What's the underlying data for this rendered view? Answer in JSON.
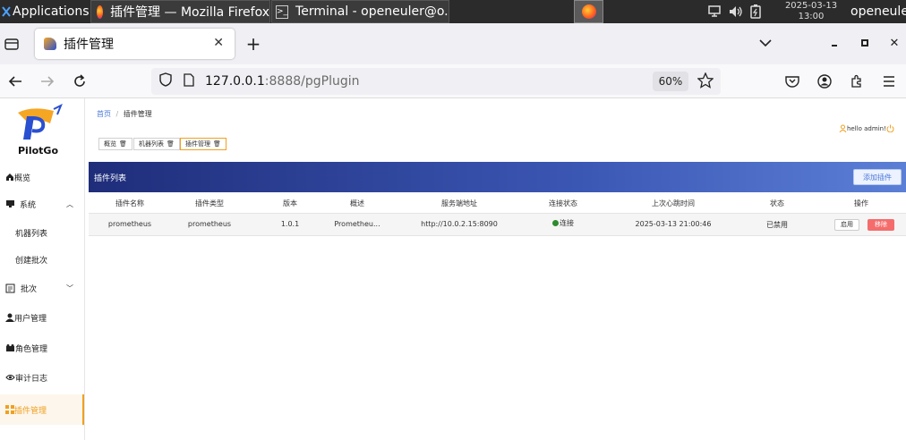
{
  "taskbar": {
    "apps_label": "Applications",
    "firefox_window": "插件管理 — Mozilla Firefox",
    "terminal_window": "Terminal - openeuler@o...",
    "date": "2025-03-13",
    "time": "13:00",
    "user": "openeuler"
  },
  "browser": {
    "tab_title": "插件管理",
    "url_host": "127.0.0.1",
    "url_rest": ":8888/pgPlugin",
    "zoom": "60%"
  },
  "sidebar": {
    "logo_text": "PilotGo",
    "items": [
      {
        "label": "概览"
      },
      {
        "label": "系统"
      },
      {
        "label": "机器列表"
      },
      {
        "label": "创建批次"
      },
      {
        "label": "批次"
      },
      {
        "label": "用户管理"
      },
      {
        "label": "角色管理"
      },
      {
        "label": "审计日志"
      },
      {
        "label": "插件管理"
      }
    ]
  },
  "breadcrumb": {
    "home": "首页",
    "sep": "/",
    "current": "插件管理"
  },
  "tags": [
    {
      "label": "概览"
    },
    {
      "label": "机器列表"
    },
    {
      "label": "插件管理"
    }
  ],
  "user_greeting": "hello admin!",
  "panel": {
    "title": "插件列表",
    "add_button": "添加插件"
  },
  "table": {
    "headers": [
      "插件名称",
      "插件类型",
      "版本",
      "概述",
      "服务端地址",
      "连接状态",
      "上次心跳时间",
      "状态",
      "操作"
    ],
    "rows": [
      {
        "name": "prometheus",
        "type": "prometheus",
        "version": "1.0.1",
        "summary": "Prometheu...",
        "address": "http://10.0.2.15:8090",
        "conn": "连接",
        "heartbeat": "2025-03-13 21:00:46",
        "status": "已禁用",
        "enable": "启用",
        "remove": "移除"
      }
    ]
  },
  "colors": {
    "accent": "#f0a020",
    "remove": "#f56c6c",
    "header_start": "#1f2d7a",
    "header_end": "#5c7fd6",
    "online": "#2e8b2e"
  }
}
